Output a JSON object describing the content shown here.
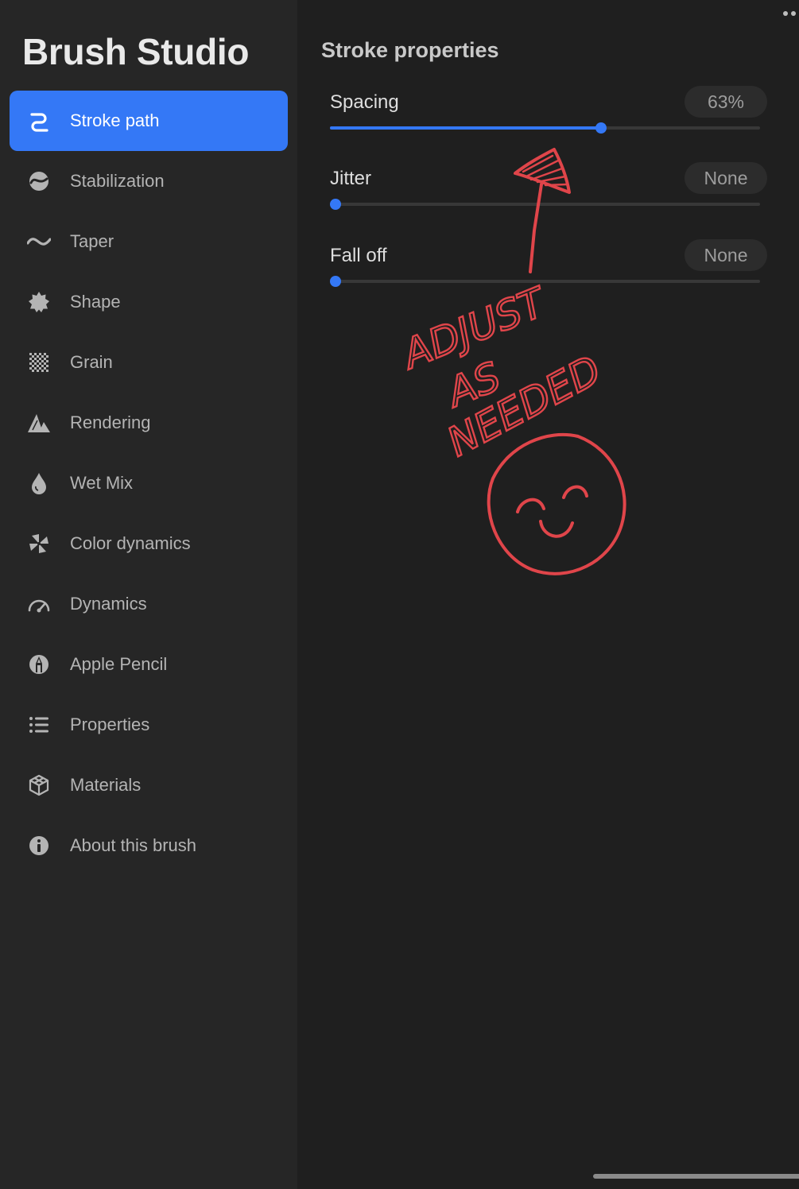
{
  "app": {
    "title": "Brush Studio"
  },
  "sidebar": {
    "items": [
      {
        "label": "Stroke path",
        "icon": "stroke-path-icon",
        "active": true
      },
      {
        "label": "Stabilization",
        "icon": "stabilization-icon"
      },
      {
        "label": "Taper",
        "icon": "taper-icon"
      },
      {
        "label": "Shape",
        "icon": "shape-icon"
      },
      {
        "label": "Grain",
        "icon": "grain-icon"
      },
      {
        "label": "Rendering",
        "icon": "rendering-icon"
      },
      {
        "label": "Wet Mix",
        "icon": "wet-mix-icon"
      },
      {
        "label": "Color dynamics",
        "icon": "color-dynamics-icon"
      },
      {
        "label": "Dynamics",
        "icon": "dynamics-icon"
      },
      {
        "label": "Apple Pencil",
        "icon": "apple-pencil-icon"
      },
      {
        "label": "Properties",
        "icon": "properties-icon"
      },
      {
        "label": "Materials",
        "icon": "materials-icon"
      },
      {
        "label": "About this brush",
        "icon": "about-icon"
      }
    ]
  },
  "main": {
    "section_title": "Stroke properties",
    "settings": [
      {
        "label": "Spacing",
        "value": "63%",
        "level": 0.63
      },
      {
        "label": "Jitter",
        "value": "None",
        "level": 0
      },
      {
        "label": "Fall off",
        "value": "None",
        "level": 0
      }
    ],
    "annotation": {
      "text": "ADJUST AS NEEDED",
      "color": "#e0454a"
    }
  },
  "colors": {
    "accent": "#3478f6",
    "background": "#1f1f1f",
    "sidebar": "#262626",
    "annotation": "#e0454a"
  }
}
